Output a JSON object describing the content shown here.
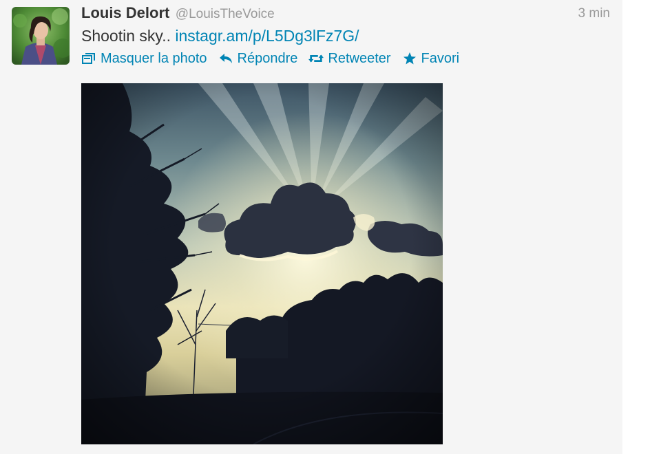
{
  "tweet": {
    "author": {
      "name": "Louis Delort",
      "handle": "@LouisTheVoice"
    },
    "timestamp": "3 min",
    "text": "Shootin sky.. ",
    "link": "instagr.am/p/L5Dg3lFz7G/",
    "actions": {
      "hide_photo": "Masquer la photo",
      "reply": "Répondre",
      "retweet": "Retweeter",
      "favorite": "Favori"
    }
  },
  "colors": {
    "link": "#0084b4",
    "name": "#333333",
    "meta": "#999999",
    "background": "#f5f5f5"
  },
  "icons": {
    "hide_photo": "photo-frame-icon",
    "reply": "reply-arrow-icon",
    "retweet": "retweet-icon",
    "favorite": "star-icon"
  }
}
